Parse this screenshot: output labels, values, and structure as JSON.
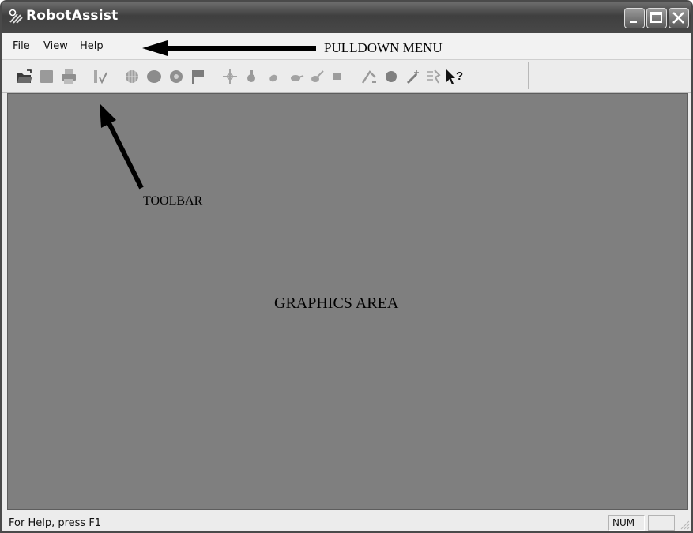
{
  "window": {
    "title": "RobotAssist",
    "app_icon": "robot-arm-icon"
  },
  "title_buttons": [
    {
      "name": "minimize-button",
      "icon": "minimize-icon"
    },
    {
      "name": "maximize-button",
      "icon": "maximize-icon"
    },
    {
      "name": "close-button",
      "icon": "close-icon"
    }
  ],
  "menu": {
    "file": "File",
    "view": "View",
    "help": "Help"
  },
  "toolbar": {
    "icons": [
      "open-folder-icon",
      "save-icon",
      "print-icon",
      "edit-check-icon",
      "grid-robot-icon",
      "robot-body-icon",
      "gear-robot-icon",
      "flag-icon",
      "move-icon",
      "joint-1-icon",
      "joint-2-icon",
      "joint-3-icon",
      "joint-4-icon",
      "stop-icon",
      "arm-icon",
      "sphere-icon",
      "tool-icon",
      "run-icon",
      "context-help-icon"
    ]
  },
  "annotations": {
    "pulldown_menu": "PULLDOWN MENU",
    "toolbar": "TOOLBAR",
    "graphics_area": "GRAPHICS AREA"
  },
  "status": {
    "help_text": "For Help, press F1",
    "num": "NUM"
  },
  "colors": {
    "titlebar": "#4a4a4a",
    "graphics_area": "#7f7f7f",
    "chrome": "#ececec"
  }
}
